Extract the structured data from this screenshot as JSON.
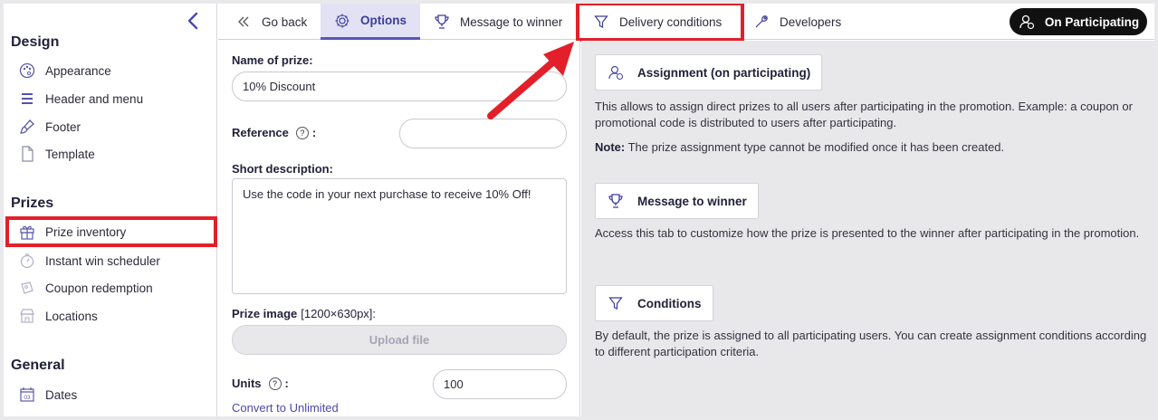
{
  "sidebar": {
    "sections": [
      {
        "title": "Design",
        "items": [
          {
            "label": "Appearance",
            "icon": "palette-icon"
          },
          {
            "label": "Header and menu",
            "icon": "menu-lines-icon"
          },
          {
            "label": "Footer",
            "icon": "brush-icon"
          },
          {
            "label": "Template",
            "icon": "document-icon"
          }
        ]
      },
      {
        "title": "Prizes",
        "items": [
          {
            "label": "Prize inventory",
            "icon": "gift-icon"
          },
          {
            "label": "Instant win scheduler",
            "icon": "stopwatch-icon"
          },
          {
            "label": "Coupon redemption",
            "icon": "coupon-icon"
          },
          {
            "label": "Locations",
            "icon": "store-icon"
          }
        ]
      },
      {
        "title": "General",
        "items": [
          {
            "label": "Dates",
            "icon": "calendar-icon",
            "icon_text": "03"
          }
        ]
      }
    ]
  },
  "tabs": [
    {
      "label": "Go back",
      "icon": "double-chevron-left-icon"
    },
    {
      "label": "Options",
      "icon": "gear-icon"
    },
    {
      "label": "Message to winner",
      "icon": "trophy-icon"
    },
    {
      "label": "Delivery conditions",
      "icon": "filter-icon"
    },
    {
      "label": "Developers",
      "icon": "wrench-icon"
    }
  ],
  "status_button": {
    "label": "On Participating",
    "icon": "user-participating-icon"
  },
  "form": {
    "name_label": "Name of prize:",
    "name_value": "10% Discount",
    "reference_label": "Reference",
    "reference_value": "",
    "help_glyph": "?",
    "colon": ":",
    "short_description_label": "Short description:",
    "short_description_value": "Use the code in your next purchase to receive 10% Off!",
    "image_label": "Prize image",
    "image_size": "[1200×630px]:",
    "upload_label": "Upload file",
    "units_label": "Units",
    "units_value": "100",
    "convert_link": "Convert to Unlimited"
  },
  "info": {
    "assignment_button": "Assignment (on participating)",
    "assignment_text": "This allows to assign direct prizes to all users after participating in the promotion. Example: a coupon or promotional code is distributed to users after participating.",
    "note_label": "Note:",
    "note_text": "The prize assignment type cannot be modified once it has been created.",
    "message_button": "Message to winner",
    "message_text": "Access this tab to customize how the prize is presented to the winner after participating in the promotion.",
    "conditions_button": "Conditions",
    "conditions_text": "By default, the prize is assigned to all participating users. You can create assignment conditions according to different participation criteria."
  },
  "colors": {
    "accent": "#4a4aaa",
    "highlight": "#e3202a",
    "active_tab_bg": "#e2e2f4"
  }
}
